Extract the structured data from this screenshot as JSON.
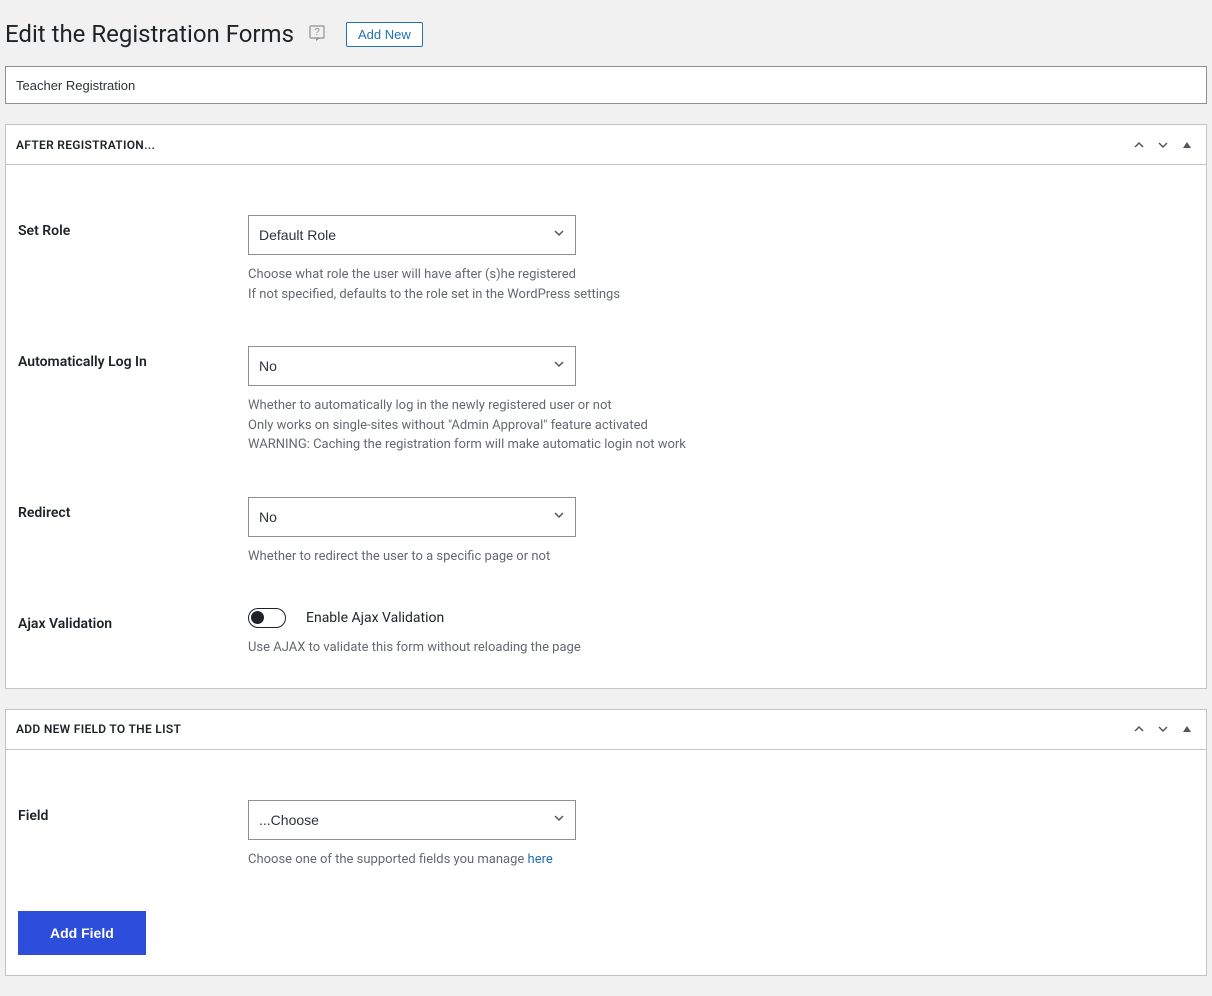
{
  "header": {
    "title": "Edit the Registration Forms",
    "add_new_label": "Add New"
  },
  "form": {
    "title_value": "Teacher Registration"
  },
  "after_registration_panel": {
    "title": "After Registration...",
    "set_role": {
      "label": "Set Role",
      "value": "Default Role",
      "description_line1": "Choose what role the user will have after (s)he registered",
      "description_line2": "If not specified, defaults to the role set in the WordPress settings"
    },
    "auto_login": {
      "label": "Automatically Log In",
      "value": "No",
      "description_line1": "Whether to automatically log in the newly registered user or not",
      "description_line2": "Only works on single-sites without \"Admin Approval\" feature activated",
      "description_line3": "WARNING: Caching the registration form will make automatic login not work"
    },
    "redirect": {
      "label": "Redirect",
      "value": "No",
      "description": "Whether to redirect the user to a specific page or not"
    },
    "ajax_validation": {
      "label": "Ajax Validation",
      "toggle_label": "Enable Ajax Validation",
      "description": "Use AJAX to validate this form without reloading the page"
    }
  },
  "add_field_panel": {
    "title": "Add New Field to the List",
    "field": {
      "label": "Field",
      "value": "...Choose",
      "description_prefix": "Choose one of the supported fields you manage ",
      "description_link": "here"
    },
    "button_label": "Add Field"
  }
}
